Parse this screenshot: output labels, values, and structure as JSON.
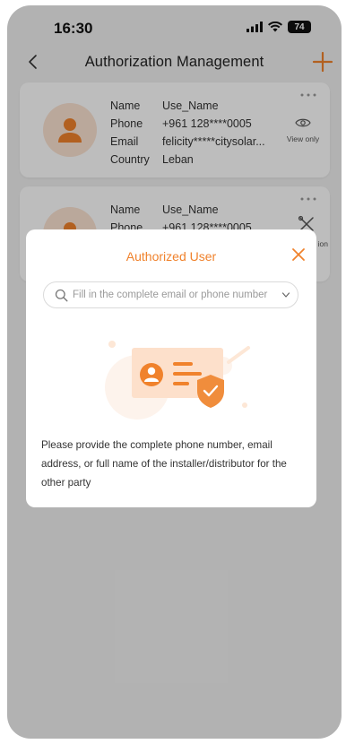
{
  "status_bar": {
    "time": "16:30",
    "battery": "74",
    "icons": [
      "signal-icon",
      "wifi-icon",
      "battery-icon"
    ]
  },
  "nav": {
    "title": "Authorization Management",
    "back_icon": "chevron-left-icon",
    "add_icon": "plus-icon"
  },
  "cards": [
    {
      "name_label": "Name",
      "name": "Use_Name",
      "phone_label": "Phone",
      "phone": "+961 128****0005",
      "email_label": "Email",
      "email": "felicity*****citysolar...",
      "country_label": "Country",
      "country": "Leban",
      "permission_label": "View only",
      "permission_icon": "eye-icon"
    },
    {
      "name_label": "Name",
      "name": "Use_Name",
      "phone_label": "Phone",
      "phone": "+961 128****0005",
      "permission_label": "ion",
      "permission_icon": "tools-icon"
    }
  ],
  "modal": {
    "title": "Authorized User",
    "search_placeholder": "Fill in the complete email or phone number",
    "search_value": "",
    "description": "Please provide the complete phone number, email address, or full name of the installer/distributor for the other party"
  },
  "colors": {
    "accent": "#f0822c",
    "avatar_bg": "#fbe3d2",
    "badge": "#f08d3c"
  }
}
